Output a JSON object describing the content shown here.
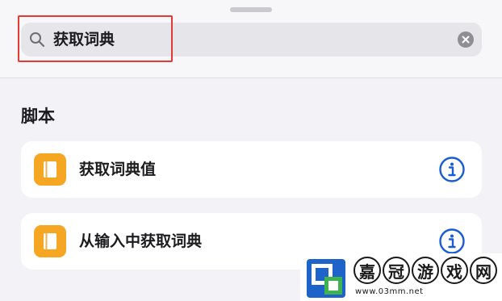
{
  "search": {
    "query": "获取词典"
  },
  "section": {
    "title": "脚本"
  },
  "results": [
    {
      "label": "获取词典值",
      "icon": "book-icon"
    },
    {
      "label": "从输入中获取词典",
      "icon": "book-icon"
    }
  ],
  "watermark": {
    "chars": [
      "嘉",
      "冠",
      "游",
      "戏",
      "网"
    ],
    "url": "www.03mm.net"
  },
  "colors": {
    "accent": "#1a5bd6",
    "app_icon": "#f5a623",
    "highlight": "#e53935"
  }
}
